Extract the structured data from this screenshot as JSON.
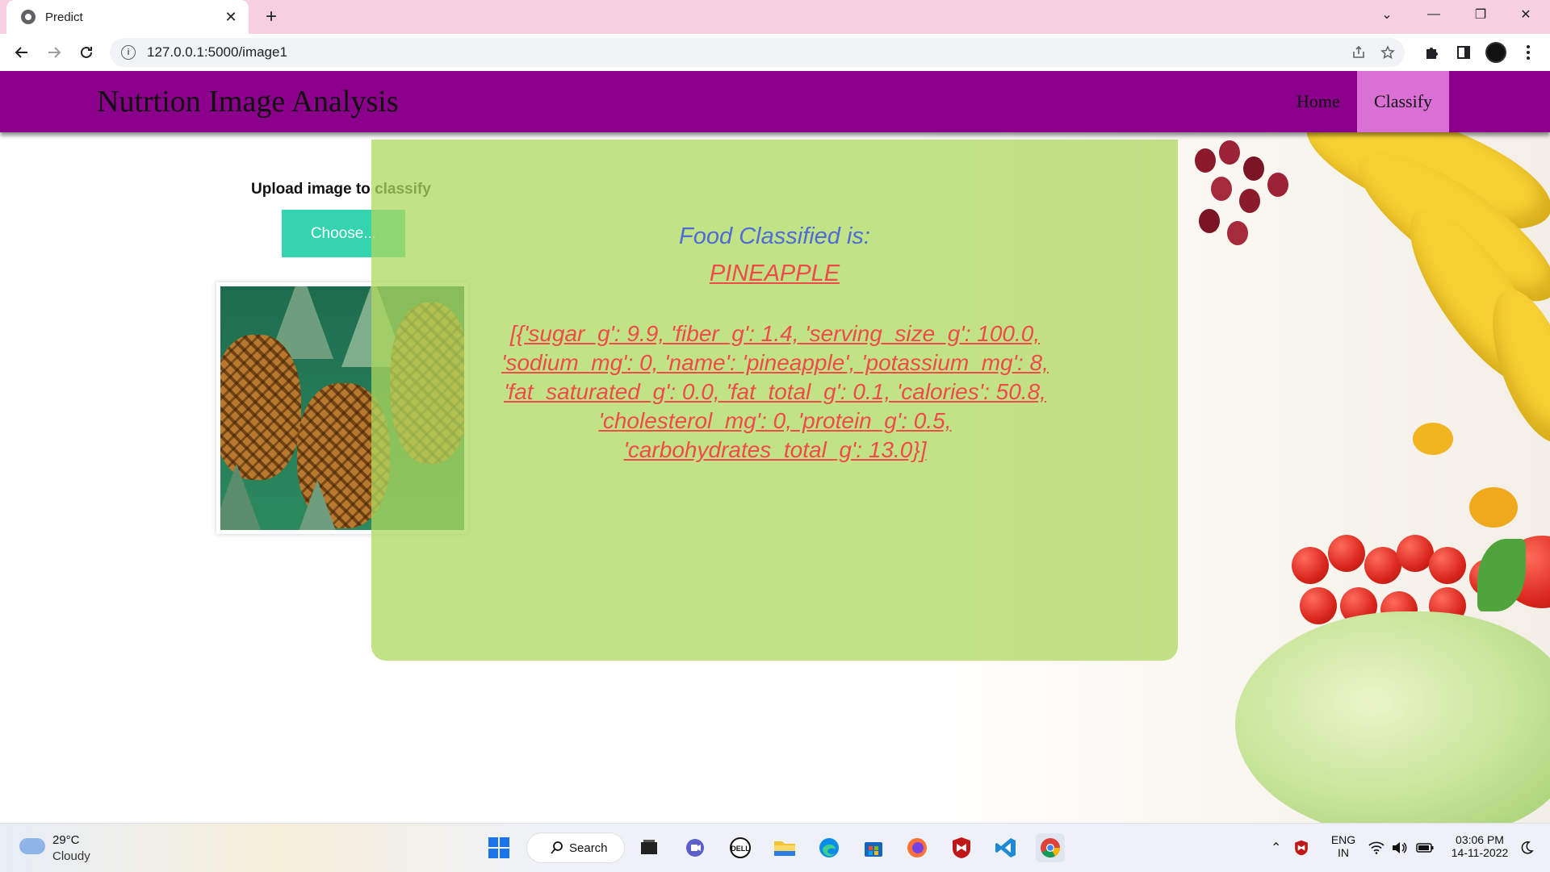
{
  "browser": {
    "tab_title": "Predict",
    "tab_close": "✕",
    "new_tab": "+",
    "url": "127.0.0.1:5000/image1",
    "win_minimize": "—",
    "win_restore": "❐",
    "win_close": "✕",
    "tab_search": "⌄"
  },
  "site": {
    "brand": "Nutrtion Image Analysis",
    "nav": [
      {
        "label": "Home"
      },
      {
        "label": "Classify"
      }
    ],
    "upload_label": "Upload image to classify",
    "choose_button": "Choose...",
    "result_heading": "Food Classified is:",
    "result_food": "PINEAPPLE",
    "result_nutrition": "[{'sugar_g': 9.9, 'fiber_g': 1.4, 'serving_size_g': 100.0, 'sodium_mg': 0, 'name': 'pineapple', 'potassium_mg': 8, 'fat_saturated_g': 0.0, 'fat_total_g': 0.1, 'calories': 50.8, 'cholesterol_mg': 0, 'protein_g': 0.5, 'carbohydrates_total_g': 13.0}]"
  },
  "taskbar": {
    "weather_temp": "29°C",
    "weather_condition": "Cloudy",
    "search_label": "Search",
    "language_line1": "ENG",
    "language_line2": "IN",
    "time": "03:06 PM",
    "date": "14-11-2022",
    "dell_label": "DELL"
  },
  "colors": {
    "navbar": "#8b008b",
    "nav_active": "#da70d6",
    "choose_button": "#34d4b1",
    "result_card": "#aed85d",
    "result_heading": "#4e6bd6",
    "result_text": "#f04a4a"
  }
}
